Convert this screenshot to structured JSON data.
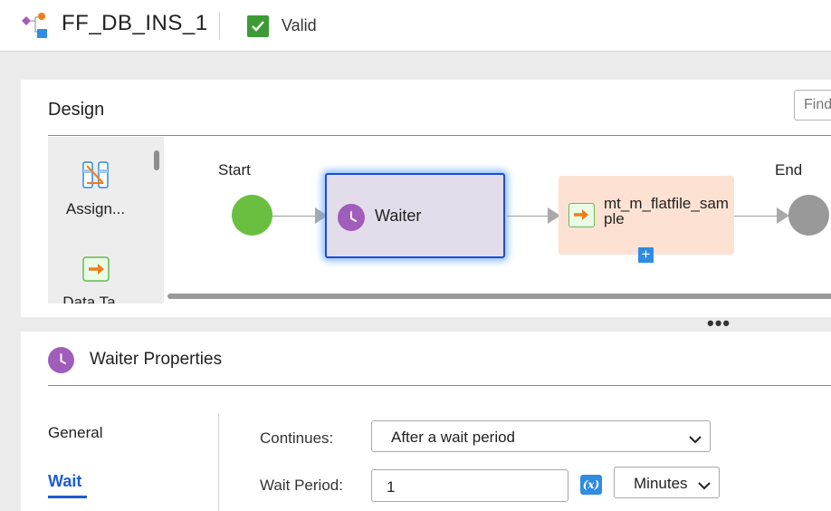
{
  "header": {
    "title": "FF_DB_INS_1",
    "status_label": "Valid",
    "status_color": "#3d9b35",
    "app_icon": "process-flow-icon"
  },
  "design": {
    "title": "Design",
    "find_placeholder": "Find",
    "palette": [
      {
        "label": "Assign...",
        "icon": "assignment-icon"
      },
      {
        "label": "Data Ta...",
        "icon": "data-task-icon"
      }
    ],
    "nodes": {
      "start_label": "Start",
      "end_label": "End",
      "waiter_label": "Waiter",
      "task_label": "mt_m_flatfile_sample",
      "add_label": "+"
    },
    "colors": {
      "start": "#6abf40",
      "end": "#999999",
      "waiter_fill": "#e3dcea",
      "waiter_border": "#1b4fd6",
      "task_fill": "#fde2d3"
    }
  },
  "more_label": "•••",
  "properties": {
    "title": "Waiter Properties",
    "tabs": {
      "general": "General",
      "wait": "Wait"
    },
    "active_tab": "Wait",
    "fields": {
      "continues_label": "Continues:",
      "continues_value": "After a wait period",
      "wait_period_label": "Wait Period:",
      "wait_period_value": "1",
      "fx_label": "(x)",
      "unit_value": "Minutes"
    }
  }
}
